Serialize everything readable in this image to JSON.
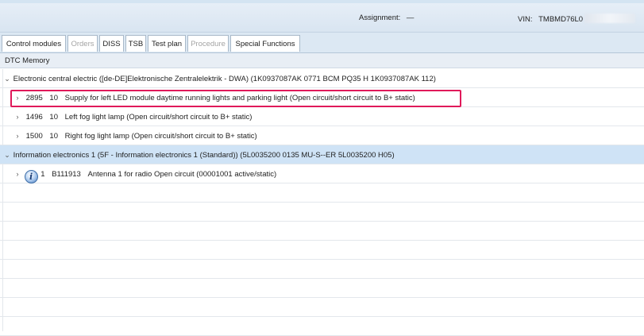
{
  "header": {
    "assignment_label": "Assignment:",
    "assignment_value": "—",
    "vin_label": "VIN:",
    "vin_value": "TMBMD76L0"
  },
  "tabs": [
    {
      "label": "Control modules",
      "enabled": true,
      "active": true
    },
    {
      "label": "Orders",
      "enabled": false
    },
    {
      "label": "DISS",
      "enabled": true
    },
    {
      "label": "TSB",
      "enabled": true
    },
    {
      "label": "Test plan",
      "enabled": true
    },
    {
      "label": "Procedure",
      "enabled": false
    },
    {
      "label": "Special Functions",
      "enabled": true
    }
  ],
  "section_title": "DTC Memory",
  "tree": {
    "module1": {
      "label": "Electronic central electric ([de-DE]Elektronische Zentralelektrik - DWA) (1K0937087AK  0771  BCM PQ35  H    1K0937087AK  112)",
      "dtcs": [
        {
          "code": "2895",
          "status": "10",
          "text": "Supply for left LED module daytime running lights and parking light  (Open circuit/short circuit to B+  static)"
        },
        {
          "code": "1496",
          "status": "10",
          "text": "Left fog light lamp  (Open circuit/short circuit to B+  static)"
        },
        {
          "code": "1500",
          "status": "10",
          "text": "Right fog light lamp  (Open circuit/short circuit to B+  static)"
        }
      ]
    },
    "module2": {
      "label": "Information electronics 1 (5F - Information electronics 1 (Standard)) (5L0035200    0135  MU-S--ER       5L0035200    H05)",
      "dtcs": [
        {
          "icon": "info-icon",
          "count": "1",
          "code": "B111913",
          "text": "Antenna 1 for radio Open circuit  (00001001   active/static)"
        }
      ]
    }
  },
  "colors": {
    "highlight": "#e0195a",
    "selected_row": "#cfe3f6",
    "header_bg": "#dce8f3"
  }
}
